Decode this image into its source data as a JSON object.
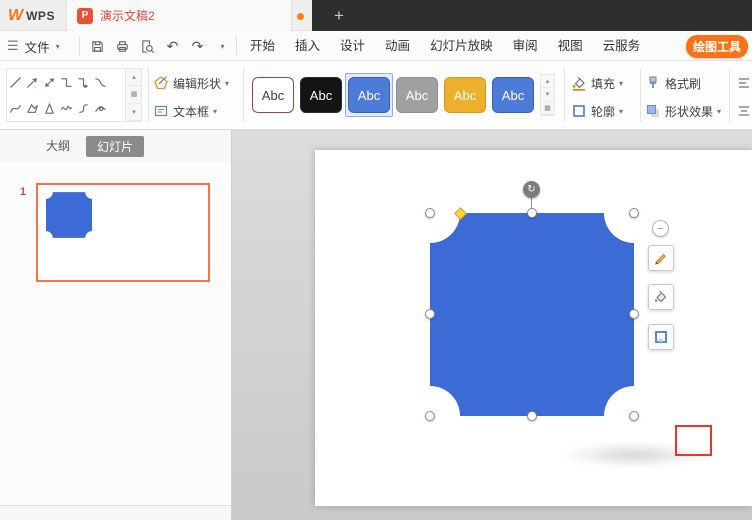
{
  "titlebar": {
    "app_name": "WPS",
    "doc_tab": "演示文稿2"
  },
  "icons": {
    "wps_logo": "W",
    "presentation_badge": "P",
    "hamburger": "☰",
    "chevron_down": "▾",
    "undo": "↶",
    "redo": "↷",
    "plus": "+",
    "minus": "−",
    "rotate": "↻",
    "scroll_up": "▴",
    "scroll_down": "▾",
    "gallery_more": "▦"
  },
  "menubar": {
    "file": "文件",
    "tabs": [
      "开始",
      "插入",
      "设计",
      "动画",
      "幻灯片放映",
      "审阅",
      "视图",
      "云服务"
    ],
    "drawing_tools": "绘图工具"
  },
  "ribbon": {
    "edit_shape": "编辑形状",
    "text_box": "文本框",
    "fill": "填充",
    "outline": "轮廓",
    "format_painter": "格式刷",
    "shape_effects": "形状效果",
    "align": "对齐",
    "styles": [
      {
        "label": "Abc",
        "bg": "#ffffff",
        "fg": "#404040",
        "border": "#8e4a43",
        "selected": false
      },
      {
        "label": "Abc",
        "bg": "#141414",
        "fg": "#ffffff",
        "border": "#2a2a2a",
        "selected": false
      },
      {
        "label": "Abc",
        "bg": "#4d7bd8",
        "fg": "#ffffff",
        "border": "#3a5fae",
        "selected": true
      },
      {
        "label": "Abc",
        "bg": "#a0a0a0",
        "fg": "#ffffff",
        "border": "#8c8c8c",
        "selected": false
      },
      {
        "label": "Abc",
        "bg": "#eeb02c",
        "fg": "#ffffff",
        "border": "#d1991a",
        "selected": false
      },
      {
        "label": "Abc",
        "bg": "#4d7bd8",
        "fg": "#ffffff",
        "border": "#3a5fae",
        "selected": false
      }
    ]
  },
  "sidebar": {
    "outline_tab": "大纲",
    "slides_tab": "幻灯片",
    "slide_number": "1"
  },
  "canvas": {
    "shape_fill": "#3d6bd5"
  },
  "colors": {
    "accent_orange": "#f97316",
    "selection_orange": "#ff7043",
    "annotation_red": "#e03a2f",
    "titlebar_dark": "#2e2e2e"
  }
}
